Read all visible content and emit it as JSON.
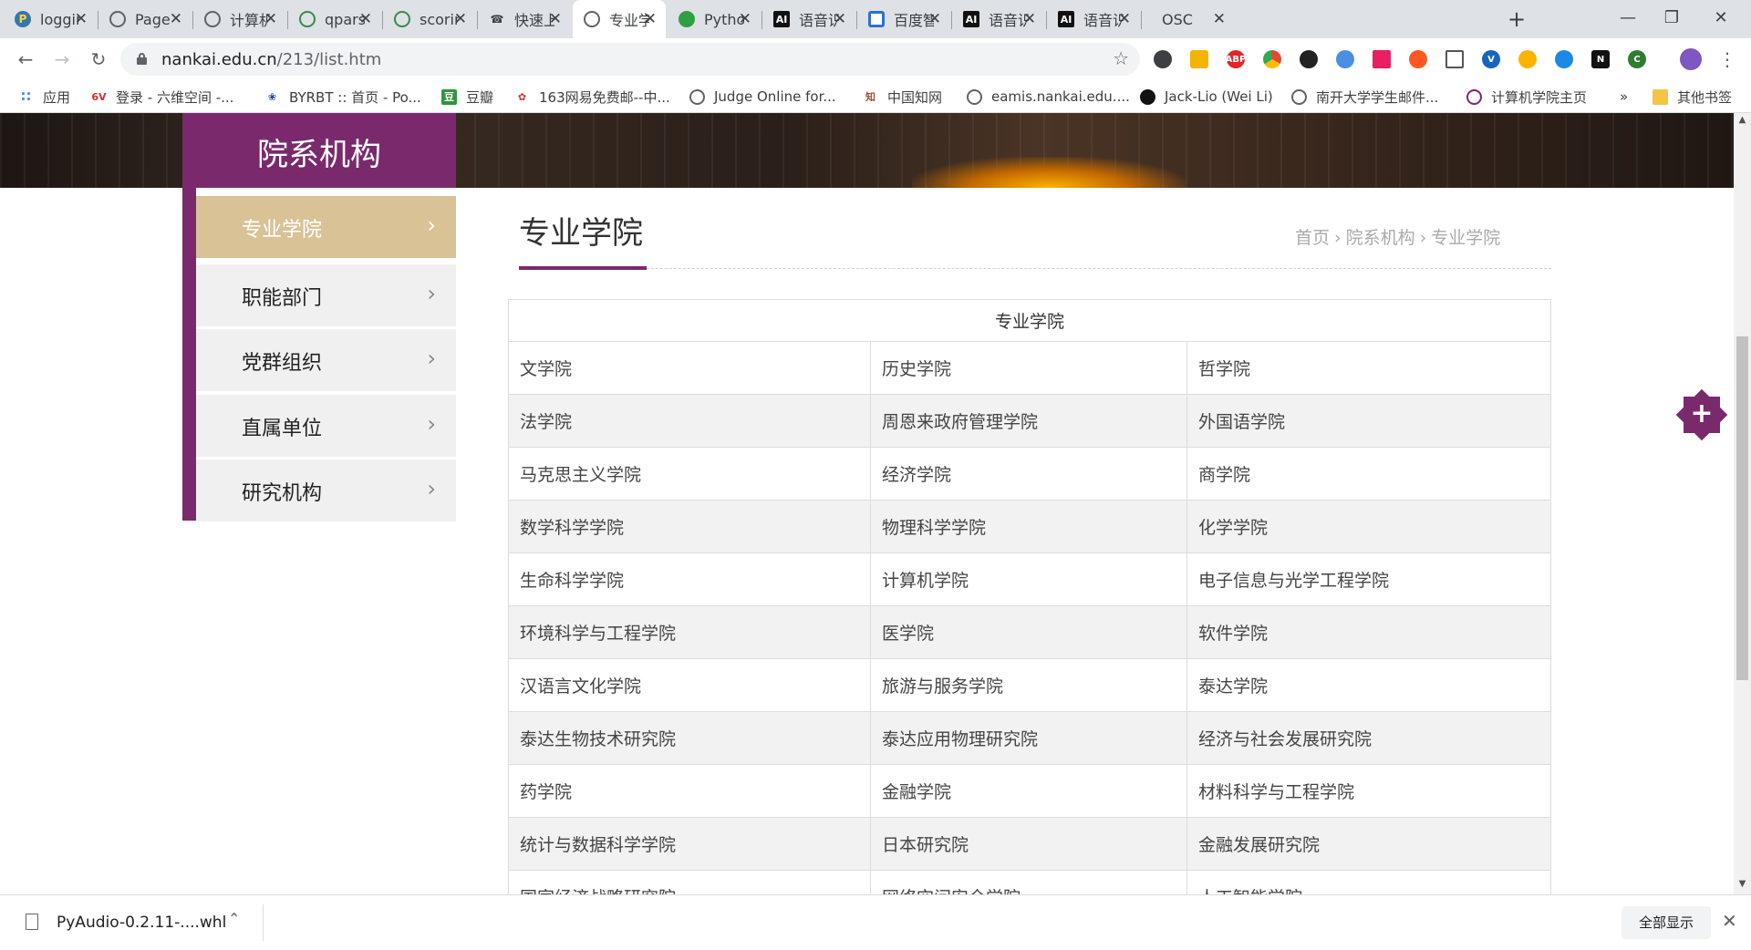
{
  "browser": {
    "tabs": [
      {
        "title": "loggin",
        "icon": "python-icon"
      },
      {
        "title": "Page T",
        "icon": "globe-icon"
      },
      {
        "title": "计算机",
        "icon": "globe-icon"
      },
      {
        "title": "qparse",
        "icon": "green-globe-icon"
      },
      {
        "title": "scorin",
        "icon": "green-globe-icon"
      },
      {
        "title": "快速上",
        "icon": "phone-icon"
      },
      {
        "title": "专业学",
        "icon": "globe-icon",
        "active": true
      },
      {
        "title": "Pytho",
        "icon": "chat-icon"
      },
      {
        "title": "语音识",
        "icon": "ai-icon"
      },
      {
        "title": "百度智",
        "icon": "baidu-icon"
      },
      {
        "title": "语音识",
        "icon": "ai-icon"
      },
      {
        "title": "语音识",
        "icon": "ai-icon"
      },
      {
        "title": "OSC",
        "icon": "none"
      }
    ],
    "new_tab": "+",
    "url_host": "nankai.edu.cn",
    "url_path": "/213/list.htm",
    "bookmarks": [
      {
        "label": "应用",
        "icon": "apps-grid-icon"
      },
      {
        "label": "登录 - 六维空间 -...",
        "icon": "6v-icon"
      },
      {
        "label": "BYRBT :: 首页 - Po...",
        "icon": "byrbt-icon"
      },
      {
        "label": "豆瓣",
        "icon": "douban-icon"
      },
      {
        "label": "163网易免费邮--中...",
        "icon": "163-icon"
      },
      {
        "label": "Judge Online for...",
        "icon": "globe-icon"
      },
      {
        "label": "中国知网",
        "icon": "cnki-icon"
      },
      {
        "label": "eamis.nankai.edu....",
        "icon": "globe-icon"
      },
      {
        "label": "Jack-Lio (Wei Li)",
        "icon": "github-icon"
      },
      {
        "label": "南开大学学生邮件...",
        "icon": "globe-icon"
      },
      {
        "label": "计算机学院主页",
        "icon": "nankai-icon"
      }
    ],
    "bookmarks_more": "»",
    "other_bookmarks": "其他书签"
  },
  "page": {
    "section_title": "院系机构",
    "menu": [
      {
        "label": "专业学院",
        "active": true
      },
      {
        "label": "职能部门"
      },
      {
        "label": "党群组织"
      },
      {
        "label": "直属单位"
      },
      {
        "label": "研究机构"
      }
    ],
    "heading": "专业学院",
    "breadcrumb": [
      "首页",
      "院系机构",
      "专业学院"
    ],
    "table_header": "专业学院",
    "rows": [
      [
        "文学院",
        "历史学院",
        "哲学院"
      ],
      [
        "法学院",
        "周恩来政府管理学院",
        "外国语学院"
      ],
      [
        "马克思主义学院",
        "经济学院",
        "商学院"
      ],
      [
        "数学科学学院",
        "物理科学学院",
        "化学学院"
      ],
      [
        "生命科学学院",
        "计算机学院",
        "电子信息与光学工程学院"
      ],
      [
        "环境科学与工程学院",
        "医学院",
        "软件学院"
      ],
      [
        "汉语言文化学院",
        "旅游与服务学院",
        "泰达学院"
      ],
      [
        "泰达生物技术研究院",
        "泰达应用物理研究院",
        "经济与社会发展研究院"
      ],
      [
        "药学院",
        "金融学院",
        "材料科学与工程学院"
      ],
      [
        "统计与数据科学学院",
        "日本研究院",
        "金融发展研究院"
      ],
      [
        "国家经济战略研究院",
        "网络空间安全学院",
        "人工智能学院"
      ]
    ],
    "float_button": "+"
  },
  "downloads": {
    "file_name": "PyAudio-0.2.11-....whl",
    "show_all": "全部显示"
  },
  "colors": {
    "brand_purple": "#7a2a6c",
    "active_menu": "#d8c296"
  }
}
